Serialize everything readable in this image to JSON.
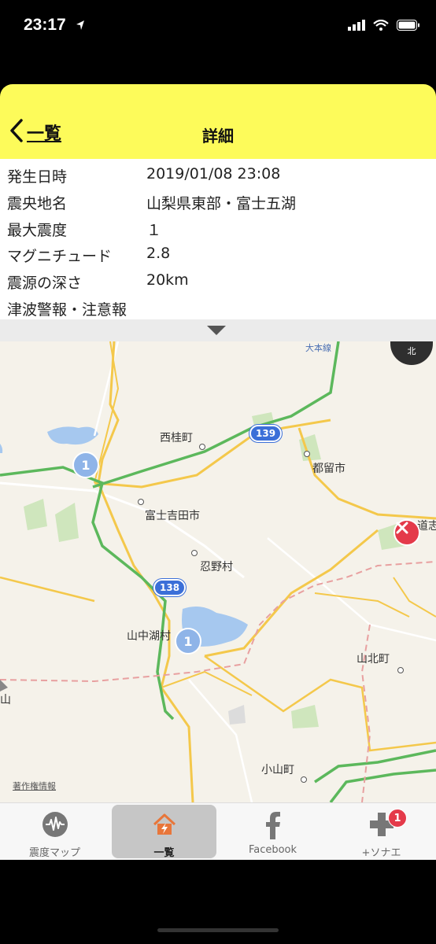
{
  "status_bar": {
    "time": "23:17"
  },
  "nav": {
    "back_label": "一覧",
    "title": "詳細"
  },
  "details": [
    {
      "label": "発生日時",
      "value": "2019/01/08 23:08"
    },
    {
      "label": "震央地名",
      "value": "山梨県東部・富士五湖"
    },
    {
      "label": "最大震度",
      "value": "１"
    },
    {
      "label": "マグニチュード",
      "value": "2.8"
    },
    {
      "label": "震源の深さ",
      "value": "20km"
    },
    {
      "label": "津波警報・注意報",
      "value": ""
    }
  ],
  "map": {
    "places": [
      "西桂町",
      "都留市",
      "富士吉田市",
      "忍野村",
      "山中湖村",
      "山北町",
      "小山町",
      "山",
      "道志"
    ],
    "routes": [
      "139",
      "138"
    ],
    "clusters": [
      "1",
      "1"
    ],
    "compass": "北",
    "credit": "著作権情報",
    "partial_label": "大本線"
  },
  "tabs": [
    {
      "label": "震度マップ",
      "icon": "waveform-icon",
      "active": false
    },
    {
      "label": "一覧",
      "icon": "house-lightning-icon",
      "active": true
    },
    {
      "label": "Facebook",
      "icon": "facebook-icon",
      "active": false
    },
    {
      "label": "+ソナエ",
      "icon": "plus-icon",
      "active": false,
      "badge": "1"
    }
  ],
  "colors": {
    "nav_background": "#fdfb5a",
    "epicenter": "#e43a4a",
    "cluster": "#8fb4e8",
    "route_shield": "#3b6fd8",
    "active_tab_icon": "#e8763a"
  }
}
